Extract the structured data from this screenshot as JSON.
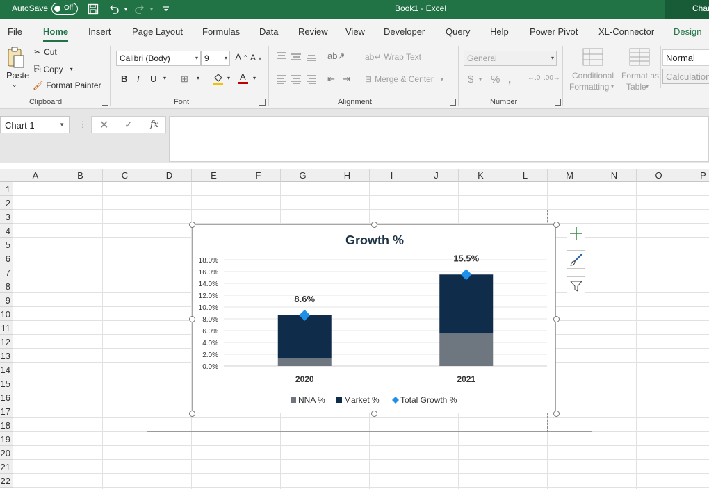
{
  "titlebar": {
    "autosave_label": "AutoSave",
    "autosave_state": "Off",
    "doc_title": "Book1  -  Excel",
    "right_tab": "Chart Tools"
  },
  "tabs": [
    "File",
    "Home",
    "Insert",
    "Page Layout",
    "Formulas",
    "Data",
    "Review",
    "View",
    "Developer",
    "Query",
    "Help",
    "Power Pivot",
    "XL-Connector",
    "Design"
  ],
  "active_tab": "Home",
  "ribbon": {
    "clipboard": {
      "paste": "Paste",
      "cut": "Cut",
      "copy": "Copy",
      "format_painter": "Format Painter",
      "group": "Clipboard"
    },
    "font": {
      "name": "Calibri (Body)",
      "size": "9",
      "group": "Font"
    },
    "alignment": {
      "wrap_text": "Wrap Text",
      "merge_center": "Merge & Center",
      "group": "Alignment"
    },
    "number": {
      "format": "General",
      "group": "Number"
    },
    "styles": {
      "conditional_line1": "Conditional",
      "conditional_line2": "Formatting",
      "format_table_line1": "Format as",
      "format_table_line2": "Table",
      "normal": "Normal",
      "calculation": "Calculation"
    }
  },
  "formula_bar": {
    "name_box": "Chart 1",
    "formula": ""
  },
  "columns": [
    "A",
    "B",
    "C",
    "D",
    "E",
    "F",
    "G",
    "H",
    "I",
    "J",
    "K",
    "L",
    "M",
    "N",
    "O",
    "P"
  ],
  "rows": [
    "1",
    "2",
    "3",
    "4",
    "5",
    "6",
    "7",
    "8",
    "9",
    "10",
    "11",
    "12",
    "13",
    "14",
    "15",
    "16",
    "17",
    "18",
    "19",
    "20",
    "21",
    "22"
  ],
  "colors": {
    "excel_green": "#217346",
    "nna": "#6e777f",
    "market": "#0f2d4a",
    "total": "#1e90e8"
  },
  "chart_data": {
    "type": "bar",
    "title": "Growth %",
    "categories": [
      "2020",
      "2021"
    ],
    "series": [
      {
        "name": "NNA %",
        "values": [
          1.3,
          5.5
        ]
      },
      {
        "name": "Market %",
        "values": [
          7.3,
          10.0
        ]
      }
    ],
    "overlay": {
      "name": "Total Growth %",
      "values": [
        8.6,
        15.5
      ],
      "labels": [
        "8.6%",
        "15.5%"
      ]
    },
    "ylim": [
      0,
      18
    ],
    "yticks": [
      "0.0%",
      "2.0%",
      "4.0%",
      "6.0%",
      "8.0%",
      "10.0%",
      "12.0%",
      "14.0%",
      "16.0%",
      "18.0%"
    ],
    "stacked": true,
    "grid": true,
    "legend": "bottom"
  }
}
